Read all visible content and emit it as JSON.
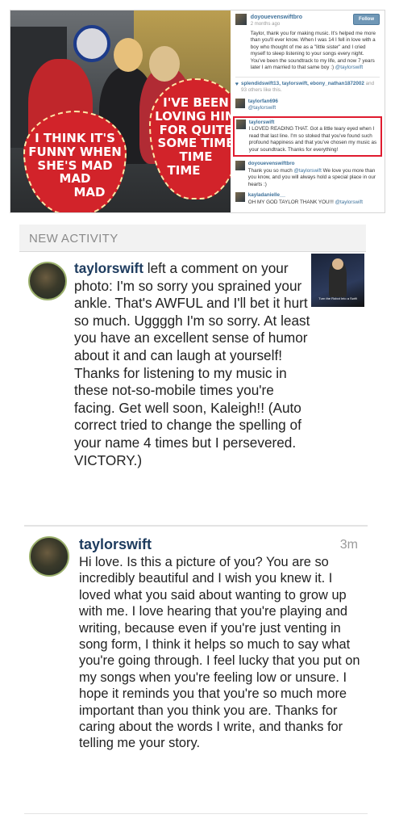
{
  "post": {
    "sign_left": [
      "I THINK IT'S",
      "FUNNY WHEN",
      "SHE'S MAD",
      "MAD",
      "MAD"
    ],
    "sign_right": [
      "I'VE BEEN",
      "LOVING HIM",
      "FOR QUITE",
      "SOME TIME",
      "TIME",
      "TIME"
    ],
    "owner": "doyouevenswiftbro",
    "time": "2 months ago",
    "follow_label": "Follow",
    "caption": "Taylor, thank you for making music. It's helped me more than you'll ever know. When I was 14 I fell in love with a boy who thought of me as a \"little sister\" and I cried myself to sleep listening to your songs every night. You've been the soundtrack to my life, and now 7 years later I am married to that same boy :)",
    "caption_tag": "@taylorswift",
    "likes_names": "splendidswift13, taylorswift, ebony_nathan1872002",
    "likes_and": "and",
    "likes_others": "93 others like this.",
    "comments": [
      {
        "user": "taylorfan696",
        "text": "",
        "tag": "@taylorswift"
      },
      {
        "user": "taylorswift",
        "text": "I LOVED READING THAT. Got a little teary eyed when I read that last line. I'm so stoked that you've found such profound happiness and that you've chosen my music as your soundtrack. Thanks for everything!",
        "tag": ""
      },
      {
        "user": "doyouevenswiftbro",
        "text": "Thank you so much",
        "tag": "@taylorswift",
        "text2": "We love you more than you know, and you will always hold a special place in our hearts :)"
      },
      {
        "user": "kayladanielle__",
        "text": "OH MY GOD TAYLOR THANK YOU!!!",
        "tag": "@taylorswift"
      }
    ]
  },
  "activity": {
    "header": "NEW ACTIVITY",
    "user": "taylorswift",
    "text": " left a comment on your photo: I'm so sorry you sprained your ankle. That's AWFUL and I'll bet it hurt so much. Uggggh I'm so sorry. At least you have an excellent sense of humor about it and can laugh at yourself! Thanks for listening to my music in these not-so-mobile times you're facing. Get well soon, Kaleigh!! (Auto correct tried to change the spelling of your name 4 times but I persevered. VICTORY.)",
    "thumb_caption": "Turn the Robot Into a Swift"
  },
  "comment": {
    "user": "taylorswift",
    "time": "3m",
    "text": "Hi love. Is this a picture of you? You are so incredibly beautiful and I wish you knew it. I loved what you said about wanting to grow up with me. I love hearing that you're playing and writing, because even if you're just venting in song form, I think it helps so much to say what you're going through. I feel lucky that you put on my songs when you're feeling low or unsure. I hope it reminds you that you're so much more important than you think you are. Thanks for caring about the words I write, and thanks for telling me your story."
  },
  "colors": {
    "instagram_link": "#3f729b",
    "username_dark": "#1d3b5e",
    "highlight_red": "#e01b2f",
    "sign_red": "#d2232a"
  }
}
